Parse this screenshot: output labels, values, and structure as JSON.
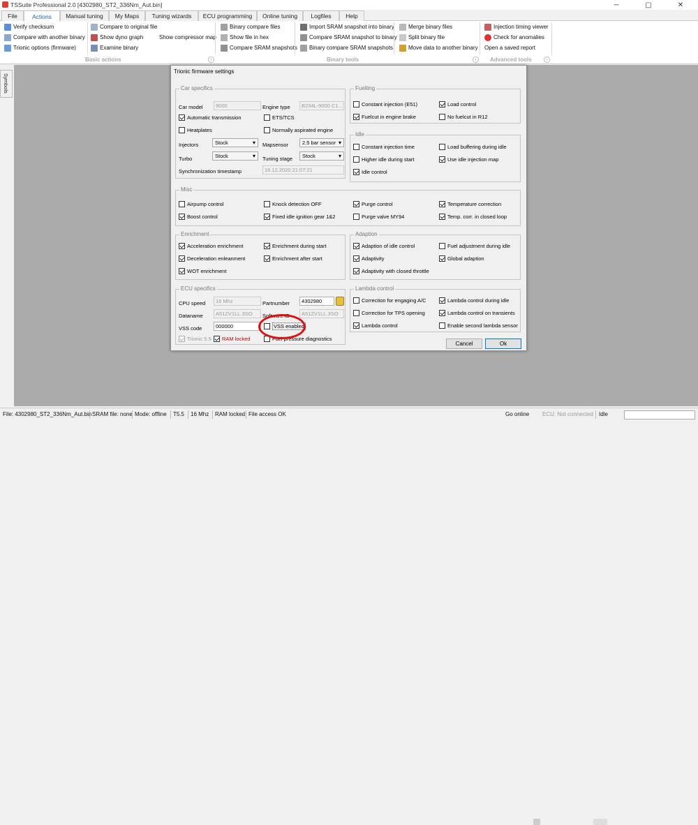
{
  "window": {
    "title": "TSSuite Professional 2.0 [4302980_ST2_336Nm_Aut.bin]",
    "minimize": "─",
    "maximize": "▢",
    "close": "✕"
  },
  "menu_tabs": [
    "File",
    "Actions",
    "Manual tuning",
    "My Maps",
    "Tuning wizards",
    "ECU programming",
    "Online tuning",
    "Logfiles",
    "Help"
  ],
  "ribbon": {
    "basic": [
      "Verify checksum",
      "Compare with another binary",
      "Trionic options (firmware)",
      "Compare to original file",
      "Show dyno graph",
      "Examine binary",
      "Show compressor map"
    ],
    "binary": [
      "Binary compare files",
      "Show file in hex",
      "Compare SRAM snapshots",
      "Import SRAM snapshot into binary",
      "Compare SRAM snapshot to binary",
      "Binary compare SRAM snapshots",
      "Merge binary files",
      "Split binary file",
      "Move data to another binary"
    ],
    "advanced": [
      "Injection timing viewer",
      "Check for anomalies",
      "Open a saved report"
    ],
    "group_labels": [
      "Basic actions",
      "Binary tools",
      "Advanced tools"
    ]
  },
  "side_panel": "Symbols",
  "dialog": {
    "title": "Trionic firmware settings",
    "car": {
      "title": "Car specifics",
      "car_model_label": "Car model",
      "car_model": "9000",
      "engine_type_label": "Engine type",
      "engine_type": "B234L-9000 C1...",
      "automatic": "Automatic transmission",
      "ets": "ETS/TCS",
      "heatplates": "Heatplates",
      "na_engine": "Normally aspirated engine",
      "injectors_label": "Injectors",
      "injectors": "Stock",
      "mapsensor_label": "Mapsensor",
      "mapsensor": "2.5 bar sensor",
      "turbo_label": "Turbo",
      "turbo": "Stock",
      "tuning_stage_label": "Tuning stage",
      "tuning_stage": "Stock",
      "sync_label": "Synchronization timestamp",
      "sync": "16.12.2020 21:07:21"
    },
    "fuel": {
      "title": "Fuelling",
      "items": [
        "Constant injection (E51)",
        "Load control",
        "Fuelcut in engine brake",
        "No fuelcut in R12"
      ]
    },
    "idle": {
      "title": "Idle",
      "items": [
        "Constant injection time",
        "Load buffering during idle",
        "Higher idle during start",
        "Use idle injection map",
        "Idle control"
      ]
    },
    "misc": {
      "title": "Misc",
      "items": [
        "Airpump control",
        "Knock detection OFF",
        "Purge control",
        "Temperature correction",
        "Boost control",
        "Fixed idle ignition gear 1&2",
        "Purge valve MY94",
        "Temp. corr. in closed loop"
      ]
    },
    "enrich": {
      "title": "Enrichment",
      "items": [
        "Acceleration enrichment",
        "Enrichment during start",
        "Deceleration enleanment",
        "Enrichment after start",
        "WOT enrichment"
      ]
    },
    "adapt": {
      "title": "Adaption",
      "items": [
        "Adaption of idle control",
        "Fuel adjustment during idle",
        "Adaptivity",
        "Global adaption",
        "Adaptivity with closed throttle"
      ]
    },
    "ecu": {
      "title": "ECU specifics",
      "cpu_label": "CPU speed",
      "cpu": "16 Mhz",
      "part_label": "Partnumber",
      "part": "4302980",
      "dataname_label": "Dataname",
      "dataname": "A51ZV1LL.3SO",
      "swid_label": "Software ID",
      "swid": "A51ZV1LL.3SO",
      "vss_label": "VSS code",
      "vss": "000000",
      "vss_enabled": "VSS enabled",
      "trionic55": "Trionic 5.5",
      "ram_locked": "RAM locked",
      "fuel_pressure": "Fuel pressure diagnostics"
    },
    "lambda": {
      "title": "Lambda control",
      "items": [
        "Correction for engaging A/C",
        "Lambda control during idle",
        "Correction for TPS opening",
        "Lambda control on transients",
        "Lambda control",
        "Enable second lambda sensor"
      ]
    },
    "cancel": "Cancel",
    "ok": "Ok"
  },
  "status": {
    "file": "File: 4302980_ST2_336Nm_Aut.bin",
    "sram": "SRAM file: none",
    "mode": "Mode: offline",
    "ts": "T5.5",
    "mhz": "16 Mhz",
    "ram": "RAM locked",
    "access": "File access OK",
    "online": "Go online",
    "ecu": "ECU: Not connected",
    "idle": "Idle"
  },
  "colors": {
    "accent": "#1e5fa8",
    "highlight_circle": "#e01010",
    "workspace": "#ababab"
  }
}
